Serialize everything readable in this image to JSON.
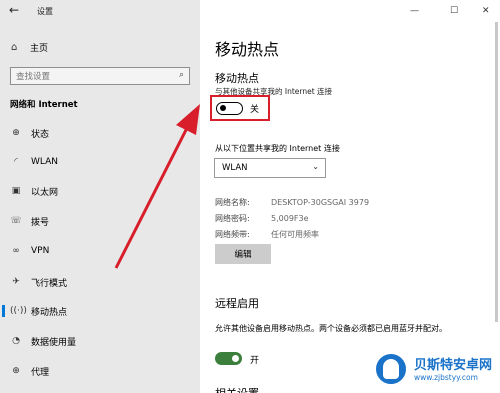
{
  "window": {
    "title": "设置",
    "minimize_glyph": "—",
    "maximize_glyph": "☐",
    "close_glyph": "✕"
  },
  "sidebar": {
    "home_label": "主页",
    "search_placeholder": "查找设置",
    "section_title": "网络和 Internet",
    "items": [
      {
        "label": "状态",
        "icon": "globe-icon"
      },
      {
        "label": "WLAN",
        "icon": "wifi-icon"
      },
      {
        "label": "以太网",
        "icon": "ethernet-icon"
      },
      {
        "label": "拨号",
        "icon": "dialup-icon"
      },
      {
        "label": "VPN",
        "icon": "vpn-icon"
      },
      {
        "label": "飞行模式",
        "icon": "airplane-icon"
      },
      {
        "label": "移动热点",
        "icon": "hotspot-icon",
        "active": true
      },
      {
        "label": "数据使用量",
        "icon": "data-usage-icon"
      },
      {
        "label": "代理",
        "icon": "globe-icon"
      }
    ]
  },
  "main": {
    "page_title": "移动热点",
    "hotspot_heading": "移动热点",
    "share_desc": "与其他设备共享我的 Internet 连接",
    "hotspot_toggle_label": "关",
    "share_from_desc": "从以下位置共享我的 Internet 连接",
    "share_from_value": "WLAN",
    "props": [
      {
        "key": "网络名称:",
        "value": "DESKTOP-30GSGAI 3979"
      },
      {
        "key": "网络密码:",
        "value": "5,009F3e"
      },
      {
        "key": "网络频带:",
        "value": "任何可用频率"
      }
    ],
    "edit_label": "编辑",
    "remote_heading": "远程启用",
    "remote_desc": "允许其他设备启用移动热点。两个设备必须都已启用蓝牙并配对。",
    "remote_toggle_label": "开",
    "next_heading": "相关设置"
  },
  "watermark": {
    "brand": "贝斯特安卓网",
    "url": "www.zjbstyy.com"
  },
  "colors": {
    "accent": "#0078d7",
    "highlight": "#d81e2b",
    "toggle_on": "#3c7f3c"
  }
}
